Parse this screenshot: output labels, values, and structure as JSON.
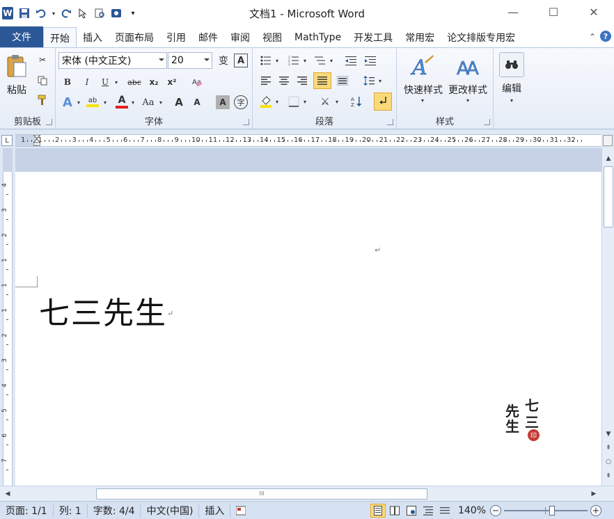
{
  "window": {
    "title": "文档1 - Microsoft Word",
    "minimize": "—",
    "maximize": "☐",
    "close": "✕"
  },
  "qat": {
    "logo": "W",
    "separator": "▾"
  },
  "tabs": [
    {
      "label": "文件"
    },
    {
      "label": "开始"
    },
    {
      "label": "插入"
    },
    {
      "label": "页面布局"
    },
    {
      "label": "引用"
    },
    {
      "label": "邮件"
    },
    {
      "label": "审阅"
    },
    {
      "label": "视图"
    },
    {
      "label": "MathType"
    },
    {
      "label": "开发工具"
    },
    {
      "label": "常用宏"
    },
    {
      "label": "论文排版专用宏"
    }
  ],
  "ribbon": {
    "clipboard": {
      "paste_label": "粘贴",
      "group_label": "剪贴板"
    },
    "font": {
      "font_name": "宋体 (中文正文)",
      "font_size": "20",
      "bold": "B",
      "italic": "I",
      "underline": "U",
      "strike": "abc",
      "subscript": "x₂",
      "superscript": "x²",
      "grow": "A",
      "shrink": "A",
      "change_case": "Aa",
      "group_label": "字体",
      "font_color": "#e02020",
      "highlight_color": "#f5e300"
    },
    "paragraph": {
      "group_label": "段落"
    },
    "styles": {
      "quick_styles": "快速样式",
      "change_styles": "更改样式",
      "group_label": "样式"
    },
    "editing": {
      "label": "编辑"
    }
  },
  "ruler": {
    "numbers": [
      "1",
      "1",
      "2",
      "3",
      "4",
      "5",
      "6",
      "7",
      "8",
      "9",
      "10",
      "11",
      "12",
      "13",
      "14",
      "15",
      "16",
      "17",
      "18",
      "19",
      "20",
      "21",
      "22",
      "23",
      "24",
      "25",
      "26",
      "27",
      "28",
      "29",
      "30",
      "31",
      "32"
    ],
    "vertical_numbers": [
      "4",
      "3",
      "2",
      "1",
      "1",
      "1",
      "2",
      "3",
      "4",
      "5",
      "6",
      "7"
    ]
  },
  "document": {
    "body_text": "七三先生",
    "para_mark": "↵",
    "seal": {
      "chars": [
        "七",
        "三",
        "先",
        "生"
      ],
      "stamp": "印"
    }
  },
  "statusbar": {
    "page": "页面: 1/1",
    "column": "列: 1",
    "word_count": "字数: 4/4",
    "language": "中文(中国)",
    "mode": "插入",
    "zoom": "140%",
    "zoom_level": 1.4
  },
  "colors": {
    "accent": "#2b5797",
    "active_button": "#fbd97a"
  }
}
